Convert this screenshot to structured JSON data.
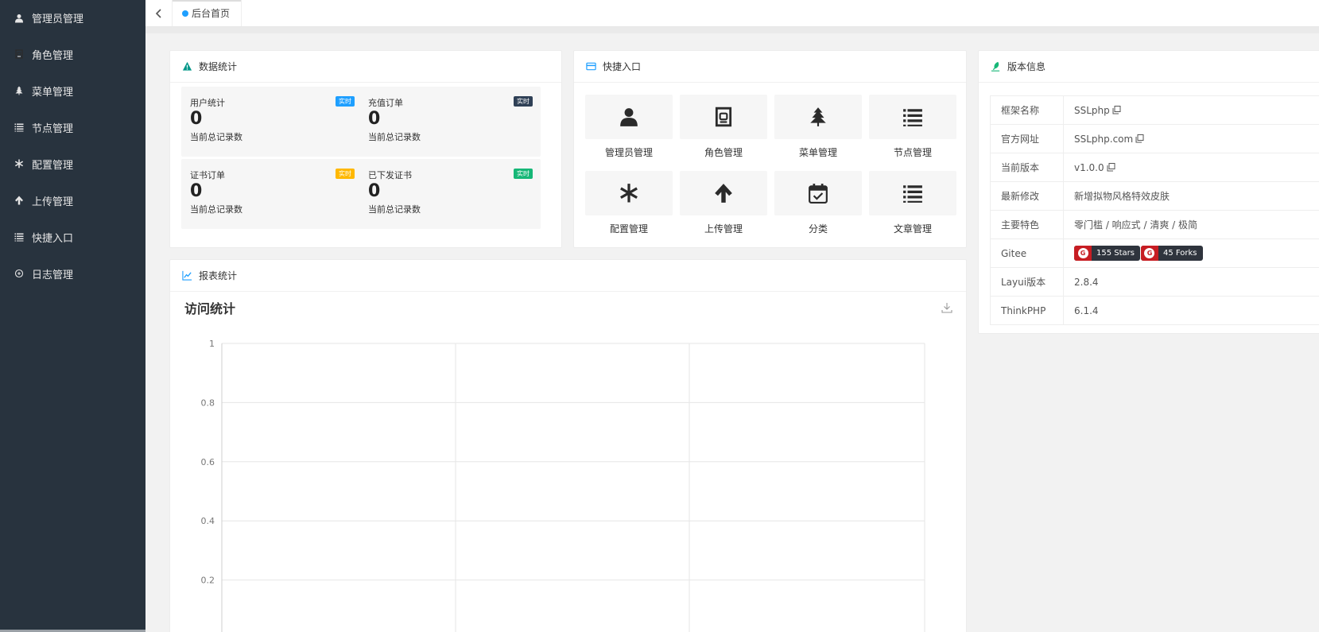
{
  "sidebar": {
    "items": [
      {
        "label": "管理员管理",
        "icon": "user-icon"
      },
      {
        "label": "角色管理",
        "icon": "role-icon"
      },
      {
        "label": "菜单管理",
        "icon": "tree-icon"
      },
      {
        "label": "节点管理",
        "icon": "list-icon"
      },
      {
        "label": "配置管理",
        "icon": "asterisk-icon"
      },
      {
        "label": "上传管理",
        "icon": "arrow-up-icon"
      },
      {
        "label": "快捷入口",
        "icon": "list-icon"
      },
      {
        "label": "日志管理",
        "icon": "log-icon"
      }
    ]
  },
  "tabbar": {
    "active_tab": "后台首页"
  },
  "stats_card": {
    "title": "数据统计",
    "items": [
      {
        "title": "用户统计",
        "badge": "实时",
        "badge_color": "#1e9fff",
        "value": "0",
        "desc": "当前总记录数"
      },
      {
        "title": "充值订单",
        "badge": "实时",
        "badge_color": "#2f4056",
        "value": "0",
        "desc": "当前总记录数"
      },
      {
        "title": "证书订单",
        "badge": "实时",
        "badge_color": "#ffb800",
        "value": "0",
        "desc": "当前总记录数"
      },
      {
        "title": "已下发证书",
        "badge": "实时",
        "badge_color": "#16b777",
        "value": "0",
        "desc": "当前总记录数"
      }
    ]
  },
  "quick_card": {
    "title": "快捷入口",
    "items": [
      {
        "label": "管理员管理",
        "icon": "user-icon"
      },
      {
        "label": "角色管理",
        "icon": "role-icon"
      },
      {
        "label": "菜单管理",
        "icon": "tree-icon"
      },
      {
        "label": "节点管理",
        "icon": "list-icon"
      },
      {
        "label": "配置管理",
        "icon": "asterisk-icon"
      },
      {
        "label": "上传管理",
        "icon": "arrow-up-icon"
      },
      {
        "label": "分类",
        "icon": "calendar-check-icon"
      },
      {
        "label": "文章管理",
        "icon": "list-icon"
      }
    ]
  },
  "version_card": {
    "title": "版本信息",
    "rows": [
      {
        "key": "框架名称",
        "value": "SSLphp",
        "copy": true
      },
      {
        "key": "官方网址",
        "value": "SSLphp.com",
        "copy": true
      },
      {
        "key": "当前版本",
        "value": "v1.0.0",
        "copy": true
      },
      {
        "key": "最新修改",
        "value": "新增拟物风格特效皮肤",
        "copy": false
      },
      {
        "key": "主要特色",
        "value": "零门槛 / 响应式 / 清爽 / 极简",
        "copy": false
      },
      {
        "key": "Gitee",
        "value": "",
        "copy": false
      },
      {
        "key": "Layui版本",
        "value": "2.8.4",
        "copy": false
      },
      {
        "key": "ThinkPHP",
        "value": "6.1.4",
        "copy": false
      }
    ],
    "gitee_badges": [
      "155 Stars",
      "45 Forks"
    ],
    "gitee_logo_letter": "G"
  },
  "report_card": {
    "title": "报表统计"
  },
  "chart_data": {
    "type": "line",
    "title": "访问统计",
    "series": [],
    "x": [],
    "ylim": [
      0,
      1
    ],
    "y_ticks": [
      "1",
      "0.8",
      "0.6",
      "0.4",
      "0.2"
    ],
    "grid": true
  },
  "colors": {
    "sidebar_bg": "#28333e",
    "accent_blue": "#1e9fff"
  }
}
